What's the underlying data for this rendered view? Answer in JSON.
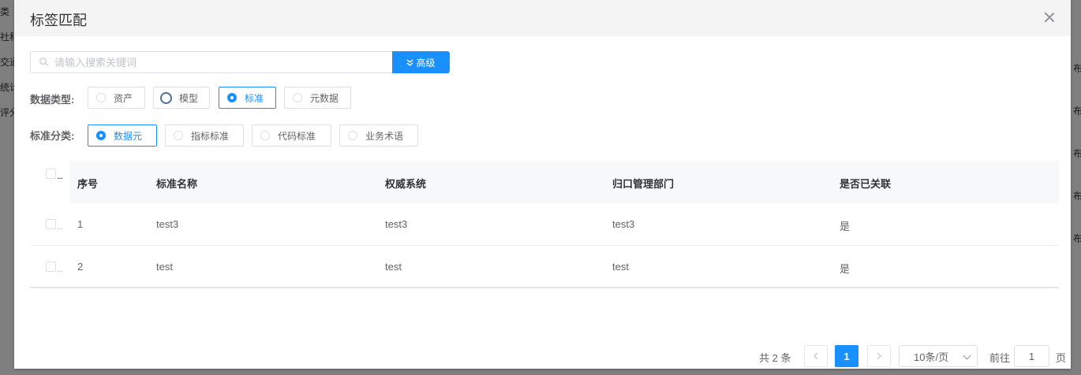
{
  "background": {
    "left_items": [
      "类",
      "社科",
      "交通",
      "统计",
      "评分"
    ],
    "right_items": [
      "布",
      "布",
      "布",
      "布",
      "布"
    ]
  },
  "dialog": {
    "title": "标签匹配"
  },
  "search": {
    "placeholder": "请输入搜索关键词",
    "advanced_label": "高级"
  },
  "filters": {
    "data_type": {
      "label": "数据类型:",
      "options": [
        "资产",
        "模型",
        "标准",
        "元数据"
      ],
      "selected": "标准"
    },
    "standard_category": {
      "label": "标准分类:",
      "options": [
        "数据元",
        "指标标准",
        "代码标准",
        "业务术语"
      ],
      "selected": "数据元"
    }
  },
  "table": {
    "headers": [
      "序号",
      "标准名称",
      "权威系统",
      "归口管理部门",
      "是否已关联"
    ],
    "header_ellipsis": "...",
    "row_ellipsis": "...",
    "rows": [
      {
        "index": "1",
        "name": "test3",
        "system": "test3",
        "department": "test3",
        "linked": "是"
      },
      {
        "index": "2",
        "name": "test",
        "system": "test",
        "department": "test",
        "linked": "是"
      }
    ]
  },
  "pagination": {
    "total": "共 2 条",
    "current_page": "1",
    "page_size": "10条/页",
    "goto_prefix": "前往",
    "goto_value": "1",
    "goto_suffix": "页",
    "prev_icon": "chevron-left-icon",
    "next_icon": "chevron-right-icon"
  },
  "colors": {
    "primary": "#1890ff",
    "overlay": "rgba(0,0,0,0.5)"
  }
}
